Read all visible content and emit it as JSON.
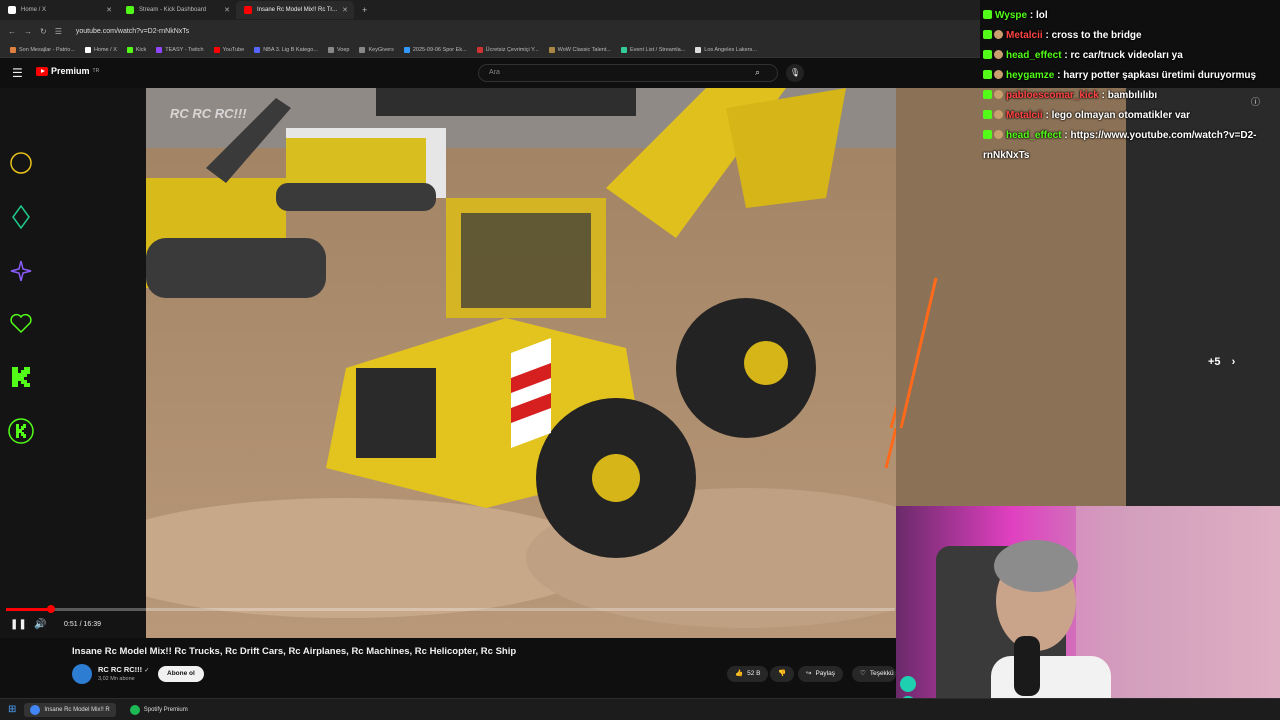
{
  "browser": {
    "tabs": [
      {
        "label": "Home / X",
        "color": "#ffffff",
        "active": false
      },
      {
        "label": "Stream - Kick Dashboard",
        "color": "#53fc18",
        "active": false
      },
      {
        "label": "Insane Rc Model Mix!! Rc Tr...",
        "color": "#ff0000",
        "active": true
      }
    ],
    "new_tab": "+",
    "url": "youtube.com/watch?v=D2-rnNkNxTs",
    "bookmarks": [
      {
        "label": "Son Mesajlar - Patrio...",
        "color": "#e08040"
      },
      {
        "label": "Home / X",
        "color": "#ffffff"
      },
      {
        "label": "Kick",
        "color": "#53fc18"
      },
      {
        "label": "TEASY - Twitch",
        "color": "#9146ff"
      },
      {
        "label": "YouTube",
        "color": "#ff0000"
      },
      {
        "label": "NBA 3. Lig B Katego...",
        "color": "#5566ff"
      },
      {
        "label": "Voep",
        "color": "#888888"
      },
      {
        "label": "KeyGivers",
        "color": "#888888"
      },
      {
        "label": "2025-09-06 Spor Ek...",
        "color": "#3399ff"
      },
      {
        "label": "Ücretsiz Çevrimiçi Y...",
        "color": "#cc3333"
      },
      {
        "label": "WoW Classic Talent...",
        "color": "#aa8844"
      },
      {
        "label": "Event List / Streamla...",
        "color": "#33cc99"
      },
      {
        "label": "Los Angeles Lakers...",
        "color": "#dddddd"
      }
    ]
  },
  "yt": {
    "logo_text": "Premium",
    "logo_sup": "TR",
    "search_placeholder": "Ara"
  },
  "player": {
    "watermark": "RC RC RC!!!",
    "time": "0:51 / 16:39",
    "progress": 0.051,
    "more_label": "+5"
  },
  "video": {
    "title": "Insane Rc Model Mix!! Rc Trucks, Rc Drift Cars, Rc Airplanes, Rc Machines, Rc Helicopter, Rc Ship",
    "channel": "RC RC RC!!!",
    "subscribers": "3,02 Mn abone",
    "subscribe_label": "Abone ol",
    "likes": "52 B",
    "share_label": "Paylaş",
    "thanks_label": "Teşekkü"
  },
  "chat": [
    {
      "user": "Wyspe",
      "user_color": "#53fc18",
      "text": "lol"
    },
    {
      "user": "Metalcii",
      "user_color": "#ff4444",
      "text": "cross to the bridge"
    },
    {
      "user": "head_effect",
      "user_color": "#53fc18",
      "text": "rc car/truck videoları ya"
    },
    {
      "user": "heygamze",
      "user_color": "#53fc18",
      "text": "harry potter şapkası üretimi duruyormuş"
    },
    {
      "user": "pabloescomar_kick",
      "user_color": "#ff4444",
      "text": "bambılılıbı"
    },
    {
      "user": "Metalcii",
      "user_color": "#ff4444",
      "text": "lego olmayan otomatikler var"
    },
    {
      "user": "head_effect",
      "user_color": "#53fc18",
      "text": "https://www.youtube.com/watch?v=D2-rnNkNxTs"
    }
  ],
  "taskbar": {
    "items": [
      {
        "label": "Insane Rc Model Mix!! R",
        "color": "#4285f4"
      },
      {
        "label": "Spotify Premium",
        "color": "#1db954"
      }
    ]
  },
  "colors": {
    "kick_green": "#53fc18",
    "yt_red": "#ff0000",
    "loader_yellow": "#e8c21a"
  }
}
